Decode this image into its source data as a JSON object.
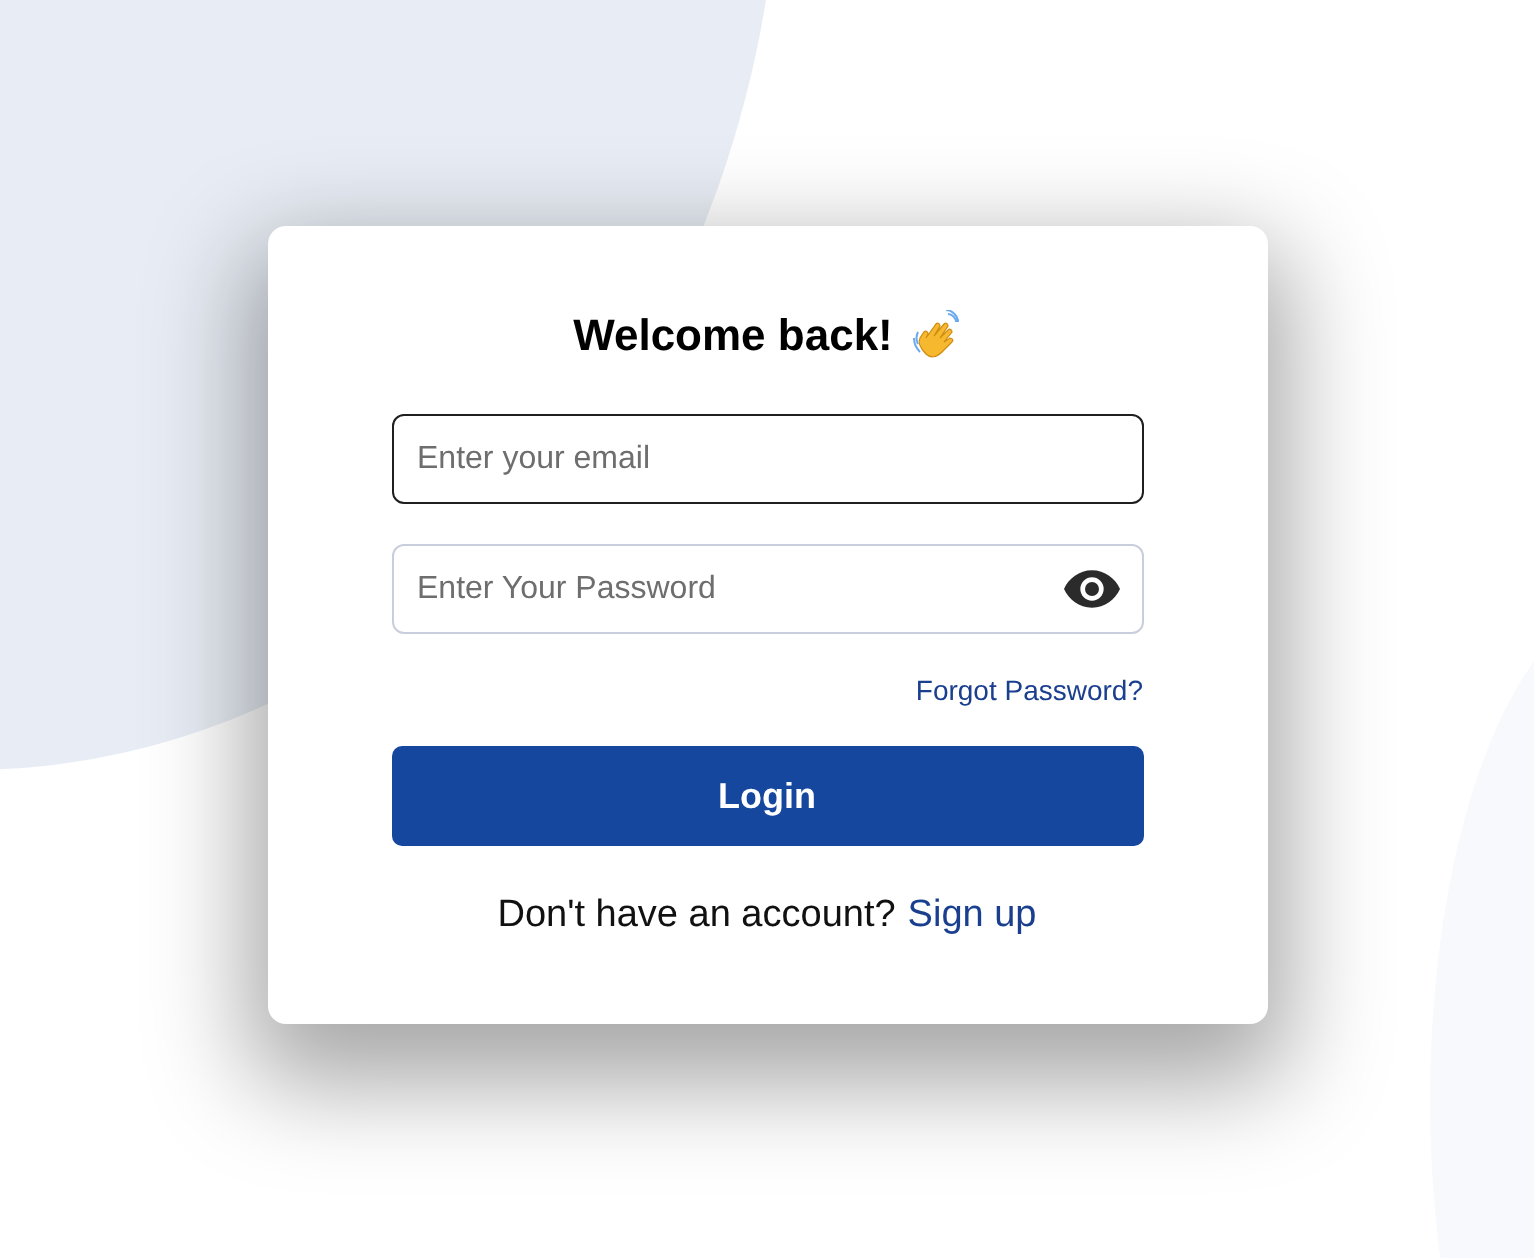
{
  "title": "Welcome back!",
  "fields": [
    {
      "kind": "email",
      "placeholder": "Enter your email",
      "focused": true
    },
    {
      "kind": "password",
      "placeholder": "Enter Your Password",
      "focused": false
    }
  ],
  "forgot_link": "Forgot Password?",
  "login_button": "Login",
  "signup": {
    "text": "Don't have an account?",
    "link": "Sign up"
  }
}
